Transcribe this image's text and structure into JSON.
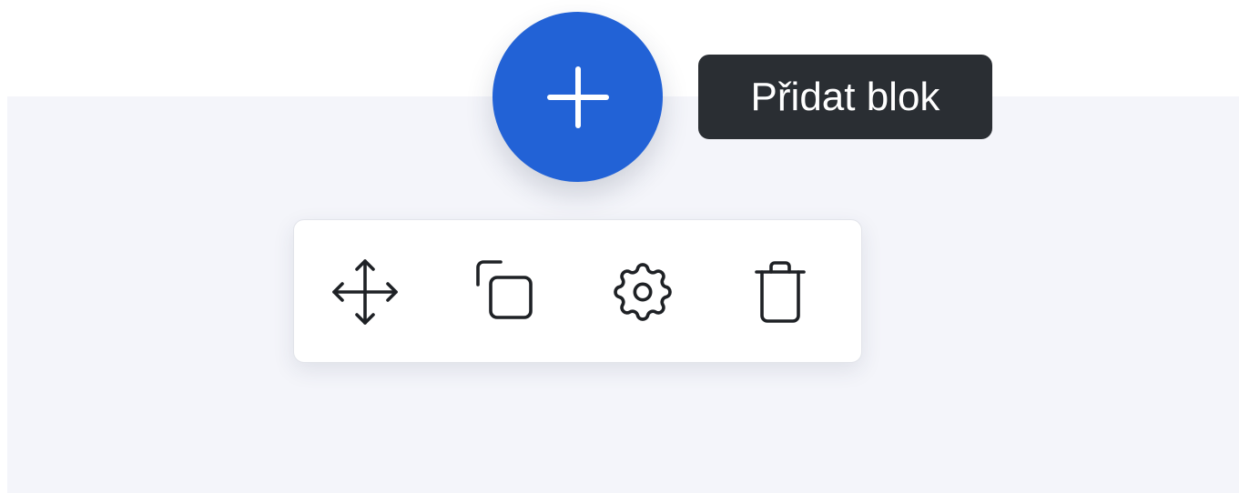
{
  "add_block": {
    "icon": "plus-icon",
    "tooltip": "Přidat blok",
    "color": "#2262d6"
  },
  "tooltip": {
    "background": "#2a2e33",
    "text_color": "#ffffff"
  },
  "block_area": {
    "background": "#f4f5fa"
  },
  "toolbar": {
    "items": [
      {
        "action": "move",
        "icon": "move-arrows-icon"
      },
      {
        "action": "duplicate",
        "icon": "copy-icon"
      },
      {
        "action": "settings",
        "icon": "gear-icon"
      },
      {
        "action": "delete",
        "icon": "trash-icon"
      }
    ]
  }
}
